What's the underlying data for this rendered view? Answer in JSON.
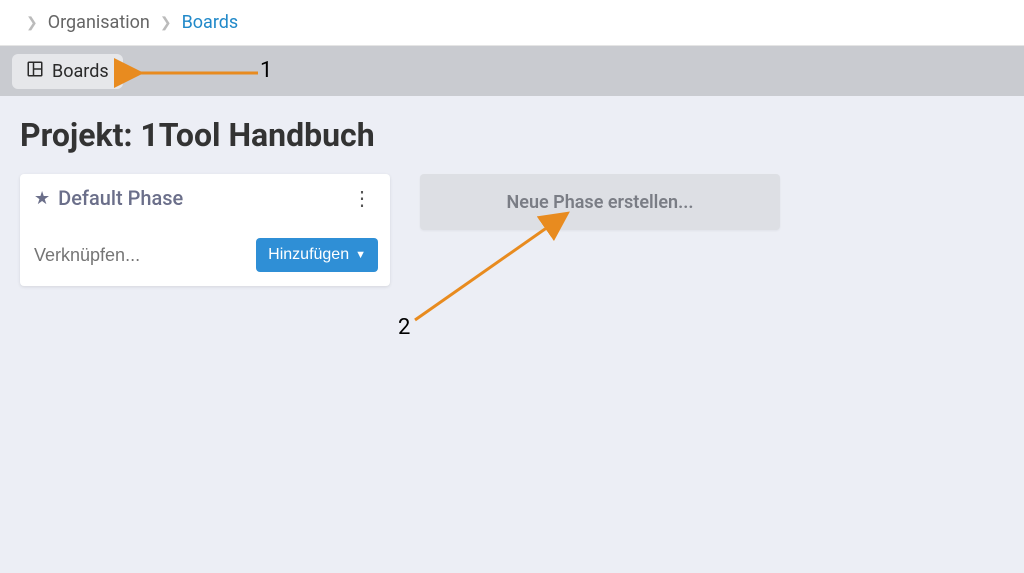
{
  "breadcrumb": {
    "item1": "Organisation",
    "item2": "Boards"
  },
  "toolbar": {
    "boards_label": "Boards"
  },
  "page": {
    "title": "Projekt: 1Tool Handbuch"
  },
  "phase_card": {
    "title": "Default Phase",
    "link_placeholder": "Verknüpfen...",
    "add_label": "Hinzufügen"
  },
  "new_phase": {
    "label": "Neue Phase erstellen..."
  },
  "annotations": {
    "label1": "1",
    "label2": "2"
  }
}
